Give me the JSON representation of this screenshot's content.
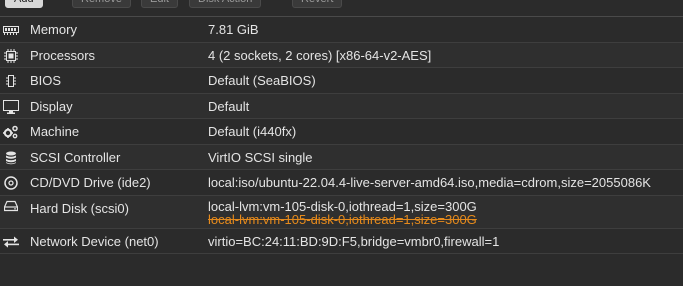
{
  "toolbar": {
    "buttons": [
      "Add",
      "Remove",
      "Edit",
      "Disk Action",
      "Revert"
    ]
  },
  "rows": [
    {
      "label": "Memory",
      "value": "7.81 GiB",
      "icon": "memory-icon"
    },
    {
      "label": "Processors",
      "value": "4 (2 sockets, 2 cores) [x86-64-v2-AES]",
      "icon": "cpu-icon"
    },
    {
      "label": "BIOS",
      "value": "Default (SeaBIOS)",
      "icon": "bios-chip-icon"
    },
    {
      "label": "Display",
      "value": "Default",
      "icon": "monitor-icon"
    },
    {
      "label": "Machine",
      "value": "Default (i440fx)",
      "icon": "cogs-icon"
    },
    {
      "label": "SCSI Controller",
      "value": "VirtIO SCSI single",
      "icon": "database-icon"
    },
    {
      "label": "CD/DVD Drive (ide2)",
      "value": "local:iso/ubuntu-22.04.4-live-server-amd64.iso,media=cdrom,size=2055086K",
      "icon": "disc-icon"
    },
    {
      "label": "Hard Disk (scsi0)",
      "value": "local-lvm:vm-105-disk-0,iothread=1,size=300G",
      "pending_value": "local-lvm:vm-105-disk-0,iothread=1,size=300G",
      "icon": "hdd-icon"
    },
    {
      "label": "Network Device (net0)",
      "value": "virtio=BC:24:11:BD:9D:F5,bridge=vmbr0,firewall=1",
      "icon": "exchange-icon"
    }
  ],
  "colors": {
    "background": "#2b2b2b",
    "text": "#e4e4e4",
    "pending": "#e58a1c"
  }
}
